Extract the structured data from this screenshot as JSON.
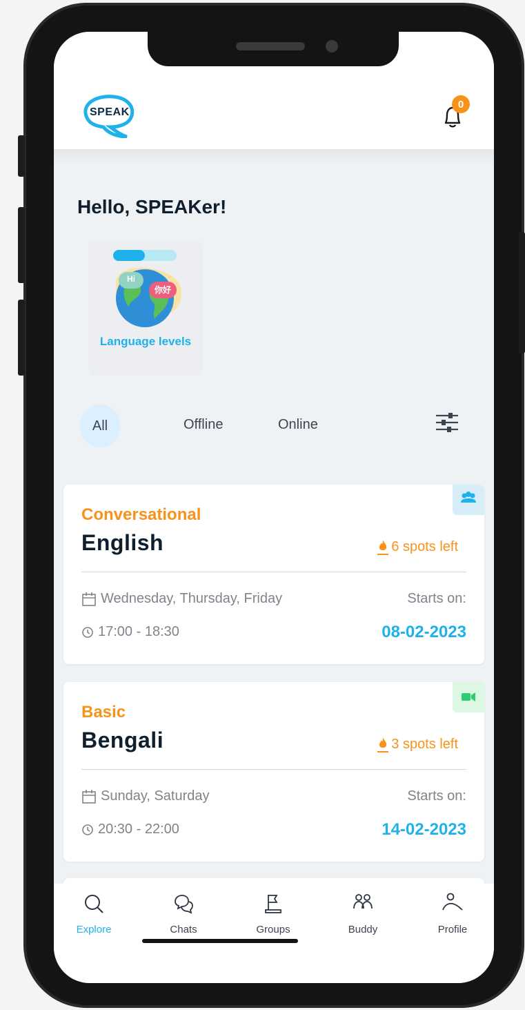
{
  "header": {
    "logo_text": "SPEAK",
    "notifications_count": "0"
  },
  "greeting": "Hello, SPEAKer!",
  "language_levels_card": {
    "label": "Language levels",
    "bubble_left": "Hi",
    "bubble_right": "你好",
    "progress": 0.5
  },
  "filters": {
    "tabs": [
      "All",
      "Offline",
      "Online"
    ],
    "selected": "All"
  },
  "courses": [
    {
      "level": "Conversational",
      "language": "English",
      "spots": "6 spots left",
      "days": "Wednesday, Thursday, Friday",
      "time": "17:00 - 18:30",
      "starts_label": "Starts on:",
      "start_date": "08-02-2023",
      "mode_icon": "group-icon",
      "mode_color": "#d7eef9"
    },
    {
      "level": "Basic",
      "language": "Bengali",
      "spots": "3 spots left",
      "days": "Sunday, Saturday",
      "time": "20:30 - 22:00",
      "starts_label": "Starts on:",
      "start_date": "14-02-2023",
      "mode_icon": "video-icon",
      "mode_color": "#dcf7e2"
    }
  ],
  "nav": {
    "items": [
      {
        "label": "Explore",
        "icon": "search-icon"
      },
      {
        "label": "Chats",
        "icon": "chat-icon"
      },
      {
        "label": "Groups",
        "icon": "groups-icon"
      },
      {
        "label": "Buddy",
        "icon": "buddy-icon"
      },
      {
        "label": "Profile",
        "icon": "profile-icon"
      }
    ],
    "active": "Explore"
  },
  "colors": {
    "accent_blue": "#1fb2ea",
    "accent_orange": "#f7931a",
    "text_dark": "#0f1f2e"
  }
}
